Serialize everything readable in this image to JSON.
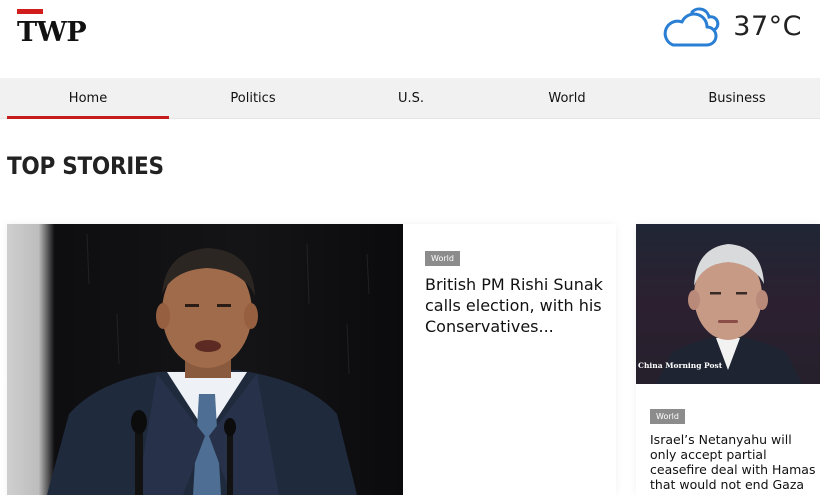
{
  "header": {
    "logo_text": "TWP",
    "weather": {
      "icon": "cloud-icon",
      "temperature": "37°C"
    }
  },
  "nav": {
    "items": [
      {
        "label": "Home",
        "active": true
      },
      {
        "label": "Politics",
        "active": false
      },
      {
        "label": "U.S.",
        "active": false
      },
      {
        "label": "World",
        "active": false
      },
      {
        "label": "Business",
        "active": false
      }
    ]
  },
  "section": {
    "title": "TOP STORIES"
  },
  "stories": [
    {
      "category": "World",
      "headline": "British PM Rishi Sunak calls election, with his Conservatives..."
    },
    {
      "category": "World",
      "headline": "Israel’s Netanyahu will only accept partial ceasefire deal with Hamas that would not end Gaza war",
      "image_watermark": "China Morning Post"
    }
  ],
  "colors": {
    "accent": "#c51c1c",
    "nav_bg": "#f1f1f1",
    "tag_bg": "#8c8c8c",
    "weather_icon": "#2a7fd4"
  }
}
